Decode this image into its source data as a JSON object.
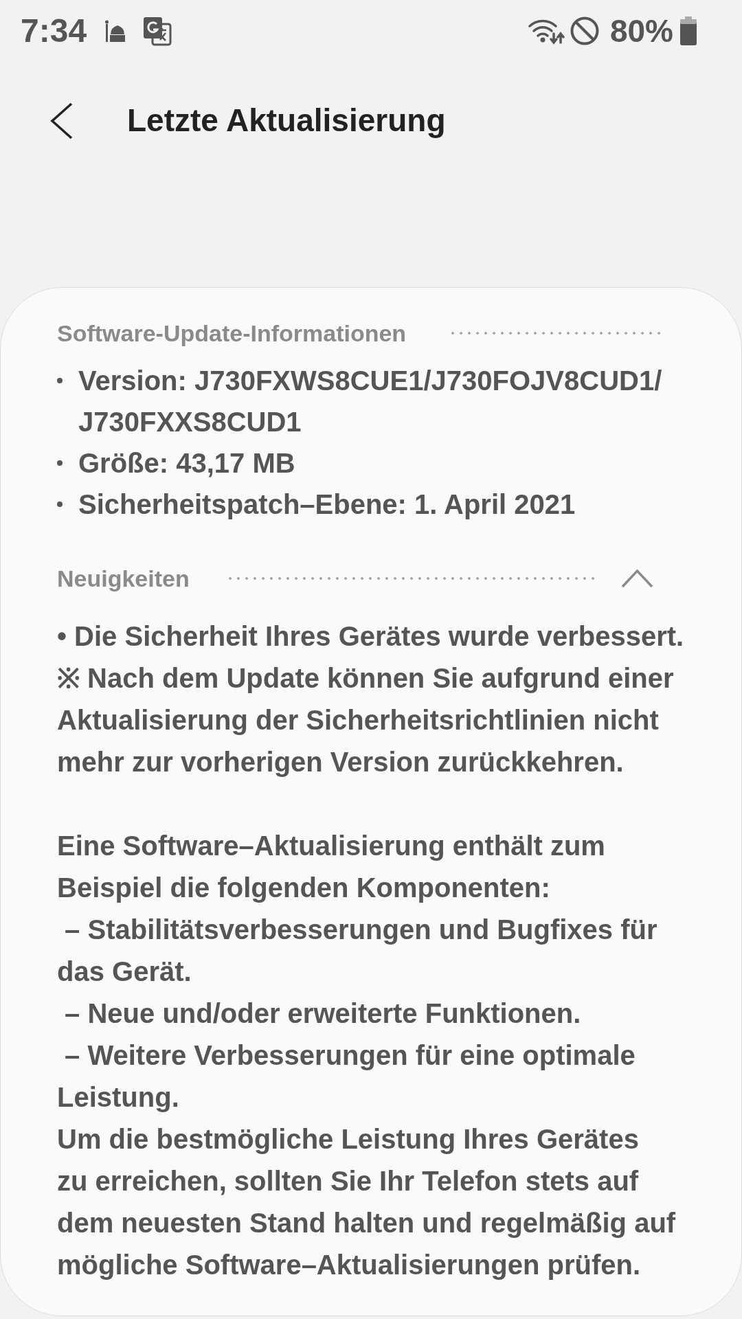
{
  "status_bar": {
    "time": "7:34",
    "battery": "80%"
  },
  "header": {
    "title": "Letzte Aktualisierung"
  },
  "sections": [
    {
      "kind": "info",
      "title": "Software-Update-Informationen",
      "items": [
        {
          "lines": [
            "Version: J730FXWS8CUE1/J730FOJV8CUD1/",
            "J730FXXS8CUD1"
          ]
        },
        {
          "lines": [
            "Größe: 43,17 MB"
          ]
        },
        {
          "lines": [
            "Sicherheitspatch–Ebene: 1. April 2021"
          ]
        }
      ]
    },
    {
      "kind": "notes",
      "title": "Neuigkeiten",
      "expanded": true,
      "paragraphs": [
        {
          "lines": [
            "• Die Sicherheit Ihres Gerätes wurde verbessert.",
            "※ Nach dem Update können Sie aufgrund einer",
            "Aktualisierung der Sicherheitsrichtlinien nicht",
            "mehr zur vorherigen Version zurückkehren."
          ]
        },
        {
          "lines": [
            "Eine Software–Aktualisierung enthält zum",
            "Beispiel die folgenden Komponenten:",
            " – Stabilitätsverbesserungen und Bugfixes für",
            "das Gerät.",
            " – Neue und/oder erweiterte Funktionen.",
            " – Weitere Verbesserungen für eine optimale",
            "Leistung.",
            "Um die bestmögliche Leistung Ihres Gerätes",
            "zu erreichen, sollten Sie Ihr Telefon stets auf",
            "dem neuesten Stand halten und regelmäßig auf",
            "mögliche Software–Aktualisierungen prüfen."
          ]
        }
      ]
    }
  ]
}
